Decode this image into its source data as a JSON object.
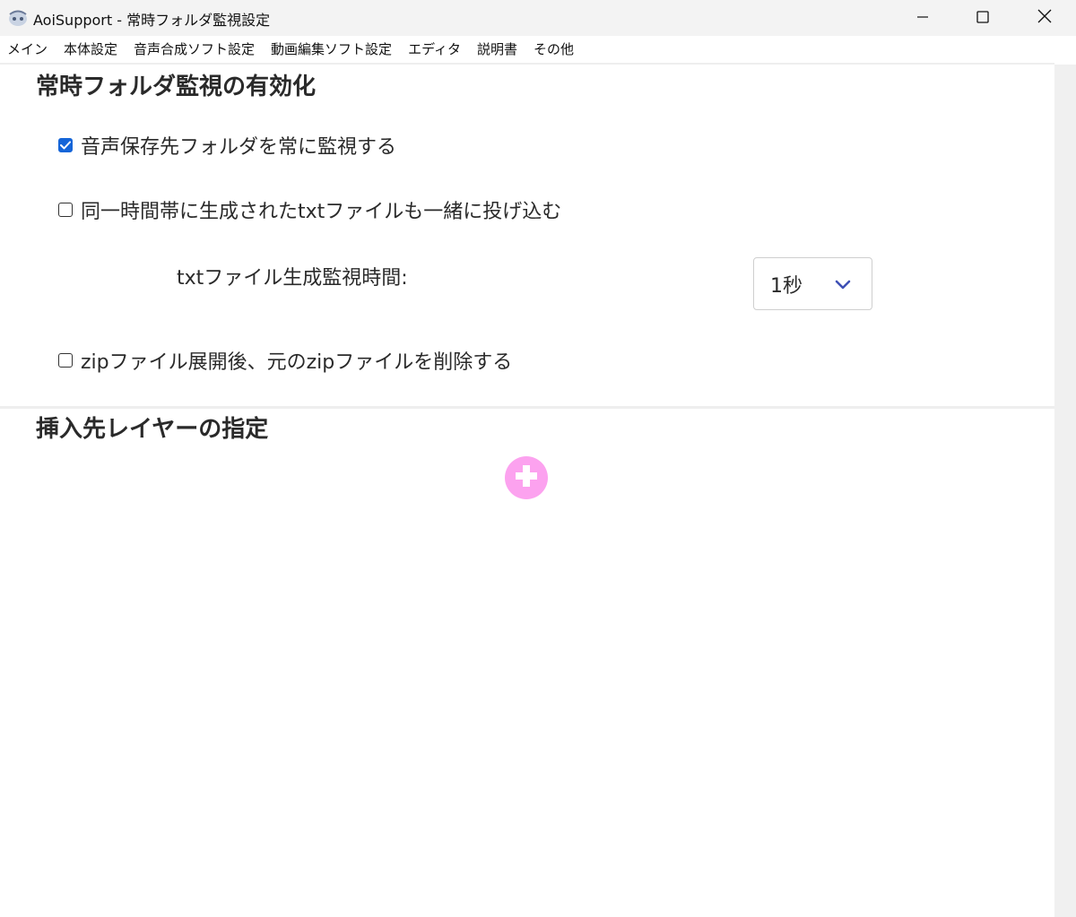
{
  "window": {
    "title": "AoiSupport - 常時フォルダ監視設定"
  },
  "menu": {
    "items": [
      {
        "label": "メイン"
      },
      {
        "label": "本体設定"
      },
      {
        "label": "音声合成ソフト設定"
      },
      {
        "label": "動画編集ソフト設定"
      },
      {
        "label": "エディタ"
      },
      {
        "label": "説明書"
      },
      {
        "label": "その他"
      }
    ]
  },
  "section_watch": {
    "title": "常時フォルダ監視の有効化",
    "options": [
      {
        "label": "音声保存先フォルダを常に監視する",
        "checked": true
      },
      {
        "label": "同一時間帯に生成されたtxtファイルも一緒に投げ込む",
        "checked": false
      },
      {
        "label": "zipファイル展開後、元のzipファイルを削除する",
        "checked": false
      }
    ],
    "txt_watch_time": {
      "label": "txtファイル生成監視時間:",
      "value": "1秒"
    }
  },
  "section_layer": {
    "title": "挿入先レイヤーの指定"
  },
  "colors": {
    "accent_checkbox": "#1565d8",
    "add_button": "#fca2ef",
    "chevron": "#3f51b5"
  },
  "icons": {
    "app": "app-logo-icon",
    "minimize": "minimize-icon",
    "maximize": "maximize-icon",
    "close": "close-icon",
    "dropdown": "chevron-down-icon",
    "add": "plus-icon"
  }
}
